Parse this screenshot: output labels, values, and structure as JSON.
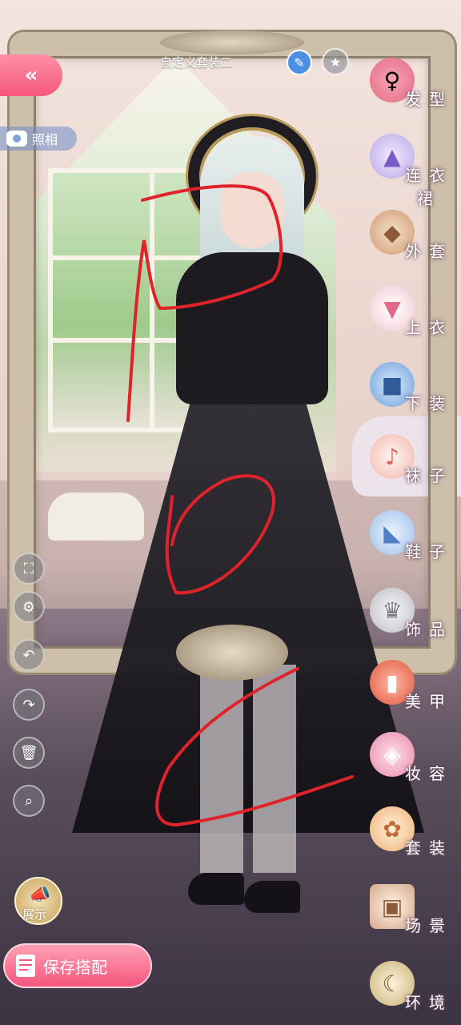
{
  "header": {
    "outfit_title": "自定义套装二",
    "back_icon": "double-chevron-left-icon",
    "edit_icon": "pencil-icon",
    "star_icon": "star-icon"
  },
  "photo_button": {
    "label": "照相",
    "icon": "camera-icon"
  },
  "categories": [
    {
      "label": "发型",
      "icon": "hairstyle-icon"
    },
    {
      "label": "连衣裙",
      "icon": "dress-icon"
    },
    {
      "label": "外套",
      "icon": "coat-icon"
    },
    {
      "label": "上衣",
      "icon": "shirt-icon"
    },
    {
      "label": "下装",
      "icon": "shorts-icon"
    },
    {
      "label": "袜子",
      "icon": "sock-icon"
    },
    {
      "label": "鞋子",
      "icon": "shoe-icon"
    },
    {
      "label": "饰品",
      "icon": "tiara-icon"
    },
    {
      "label": "美甲",
      "icon": "nail-polish-icon"
    },
    {
      "label": "妆容",
      "icon": "makeup-icon"
    },
    {
      "label": "套装",
      "icon": "outfit-set-icon"
    },
    {
      "label": "场景",
      "icon": "scene-frame-icon"
    },
    {
      "label": "环境",
      "icon": "moon-environment-icon"
    }
  ],
  "tools": [
    {
      "icon": "expand-icon"
    },
    {
      "icon": "gear-icon"
    },
    {
      "icon": "undo-icon"
    },
    {
      "icon": "redo-icon"
    },
    {
      "icon": "trash-icon"
    },
    {
      "icon": "zoom-icon"
    }
  ],
  "show_button": {
    "label": "展示",
    "icon": "megaphone-icon"
  },
  "save_button": {
    "label": "保存搭配",
    "icon": "document-icon"
  },
  "colors": {
    "accent_pink": "#f5577a",
    "edit_blue": "#4e8fe6",
    "scribble_red": "#e0232b",
    "frame_gold": "#cdbfa9"
  }
}
